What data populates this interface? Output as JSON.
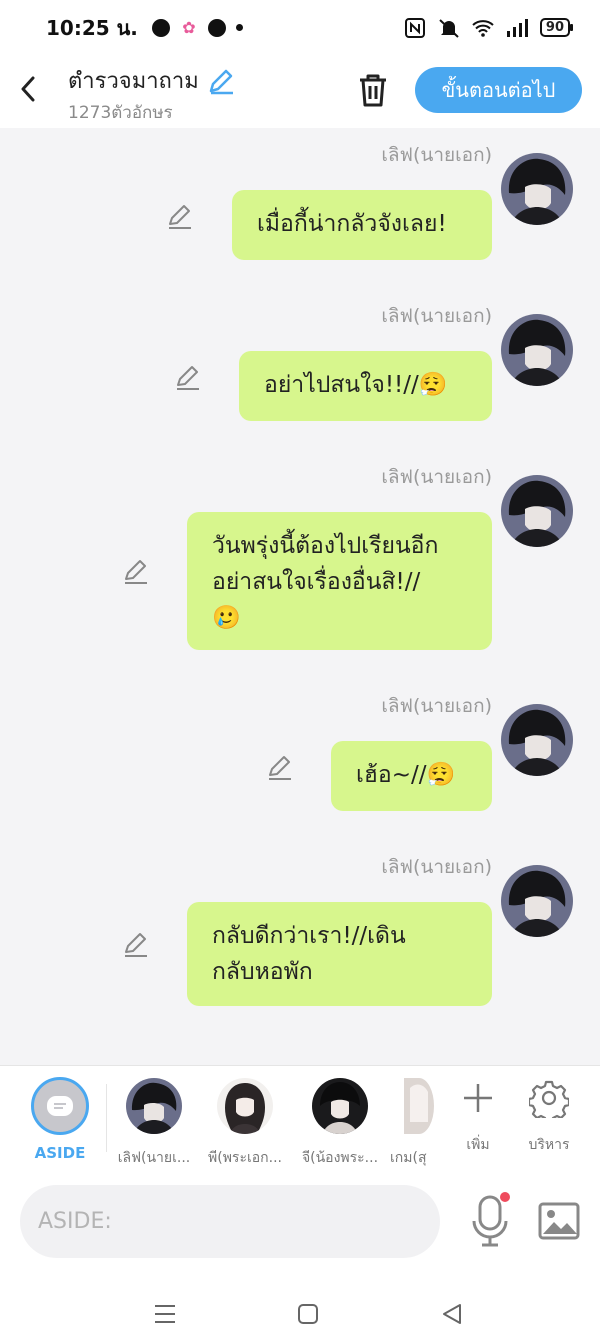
{
  "status_bar": {
    "time": "10:25 น.",
    "battery": "90",
    "icons": [
      "chat-bubble-icon",
      "photos-icon",
      "line-app-icon",
      "nfc-icon",
      "vibrate-off-icon",
      "wifi-icon",
      "signal-icon"
    ]
  },
  "header": {
    "title": "ตำรวจมาถาม",
    "char_count": "1273ตัวอักษร",
    "next_label": "ขั้นตอนต่อไป",
    "accent_color": "#4aa8f0"
  },
  "messages": [
    {
      "sender": "เลิฟ(นายเอก)",
      "text": [
        "เมื่อกี้น่ากลัวจังเลย!"
      ],
      "emoji": ""
    },
    {
      "sender": "เลิฟ(นายเอก)",
      "text": [
        "อย่าไปสนใจ!!//"
      ],
      "emoji": "😮‍💨"
    },
    {
      "sender": "เลิฟ(นายเอก)",
      "text": [
        "วันพรุ่งนี้ต้องไปเรียนอีก",
        "อย่าสนใจเรื่องอื่นสิ!//"
      ],
      "emoji": "🥲"
    },
    {
      "sender": "เลิฟ(นายเอก)",
      "text": [
        "เฮ้อ~//"
      ],
      "emoji": "😮‍💨"
    },
    {
      "sender": "เลิฟ(นายเอก)",
      "text": [
        "กลับดีกว่าเรา!//เดิน",
        "กลับหอพัก"
      ],
      "emoji": ""
    }
  ],
  "bubble_color": "#d7f68d",
  "character_bar": {
    "aside_label": "ASIDE",
    "characters": [
      {
        "name": "เลิฟ(นายเ..."
      },
      {
        "name": "พี(พระเอก..."
      },
      {
        "name": "จี(น้องพระ..."
      },
      {
        "name": "เกม(สุ"
      }
    ],
    "add_label": "เพิ่ม",
    "manage_label": "บริหาร"
  },
  "input": {
    "placeholder": "ASIDE:"
  }
}
